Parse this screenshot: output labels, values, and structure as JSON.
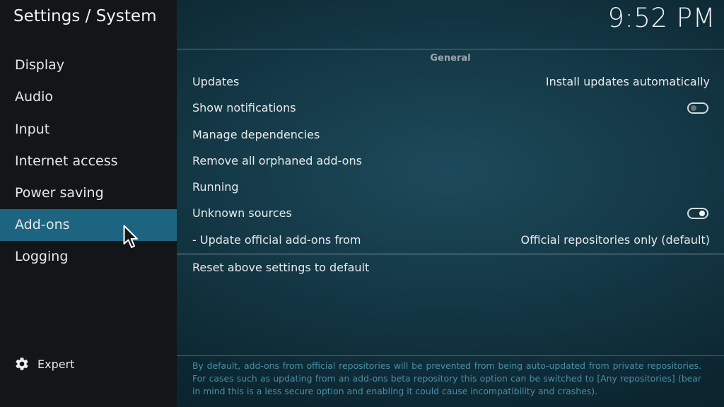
{
  "header": {
    "title": "Settings / System",
    "clock": "9:52 PM"
  },
  "sidebar": {
    "items": [
      {
        "label": "Display"
      },
      {
        "label": "Audio"
      },
      {
        "label": "Input"
      },
      {
        "label": "Internet access"
      },
      {
        "label": "Power saving"
      },
      {
        "label": "Add-ons",
        "active": true
      },
      {
        "label": "Logging"
      }
    ],
    "expert_label": "Expert",
    "expert_icon": "gear-icon"
  },
  "main": {
    "section_title": "General",
    "settings": [
      {
        "label": "Updates",
        "value": "Install updates automatically"
      },
      {
        "label": "Show notifications",
        "toggle": "off"
      },
      {
        "label": "Manage dependencies"
      },
      {
        "label": "Remove all orphaned add-ons"
      },
      {
        "label": "Running"
      },
      {
        "label": "Unknown sources",
        "toggle": "on"
      },
      {
        "label": "- Update official add-ons from",
        "value": "Official repositories only (default)"
      }
    ],
    "reset_label": "Reset above settings to default",
    "description": "By default, add-ons from official repositories will be prevented from being auto-updated from private repositories. For cases such as updating from an add-ons beta repository this option can be switched to [Any repositories] (bear in mind this is a less secure option and enabling it could cause incompatibility and crashes)."
  },
  "colors": {
    "accent": "#1d6480",
    "sidebar_bg": "#121619",
    "description_text": "#4a8ea6"
  }
}
